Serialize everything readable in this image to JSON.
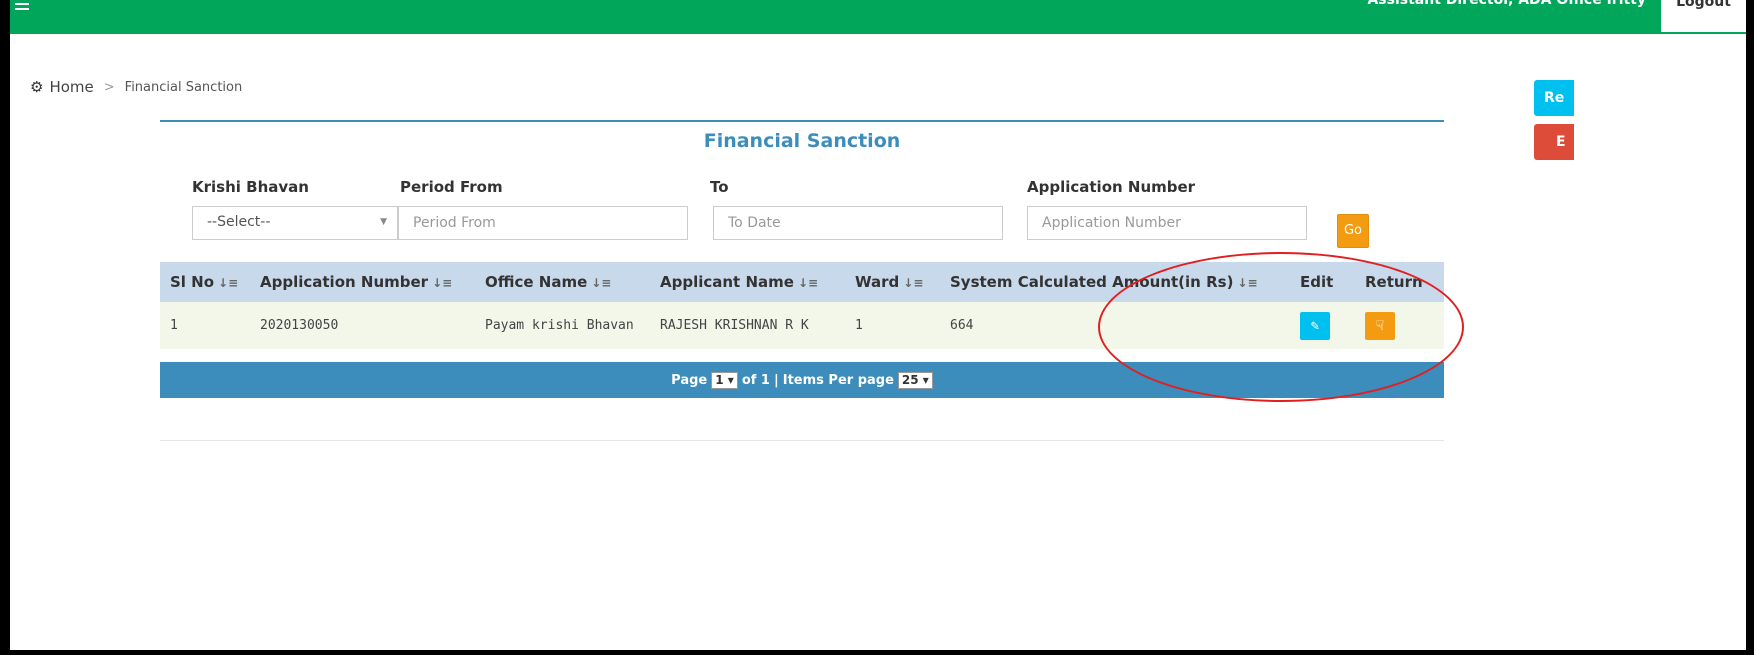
{
  "header": {
    "user_text": "Assistant Director, ADA Office Iritty",
    "logout_label": "Logout"
  },
  "breadcrumb": {
    "home": "Home",
    "separator": ">",
    "current": "Financial Sanction"
  },
  "side_buttons": {
    "blue_label": "Re",
    "red_label": "E"
  },
  "panel": {
    "title": "Financial Sanction"
  },
  "filters": {
    "krishi_bhavan_label": "Krishi Bhavan",
    "krishi_bhavan_value": "--Select--",
    "period_from_label": "Period From",
    "period_from_placeholder": "Period From",
    "to_label": "To",
    "to_placeholder": "To Date",
    "application_number_label": "Application Number",
    "application_number_placeholder": "Application Number",
    "go_label": "Go"
  },
  "table": {
    "columns": [
      "Sl No",
      "Application Number",
      "Office Name",
      "Applicant Name",
      "Ward",
      "System Calculated Amount(in Rs)",
      "Edit",
      "Return"
    ],
    "rows": [
      {
        "sl_no": "1",
        "application_number": "2020130050",
        "office_name": "Payam krishi Bhavan",
        "applicant_name": "RAJESH KRISHNAN R K",
        "ward": "1",
        "amount": "664"
      }
    ]
  },
  "pager": {
    "page_label": "Page",
    "page_value": "1",
    "of_label": "of 1",
    "separator": "|",
    "items_label": "Items Per page",
    "items_value": "25"
  },
  "colors": {
    "topbar": "#02a65a",
    "accent": "#3c8dbc",
    "annotation": "#e02020"
  }
}
